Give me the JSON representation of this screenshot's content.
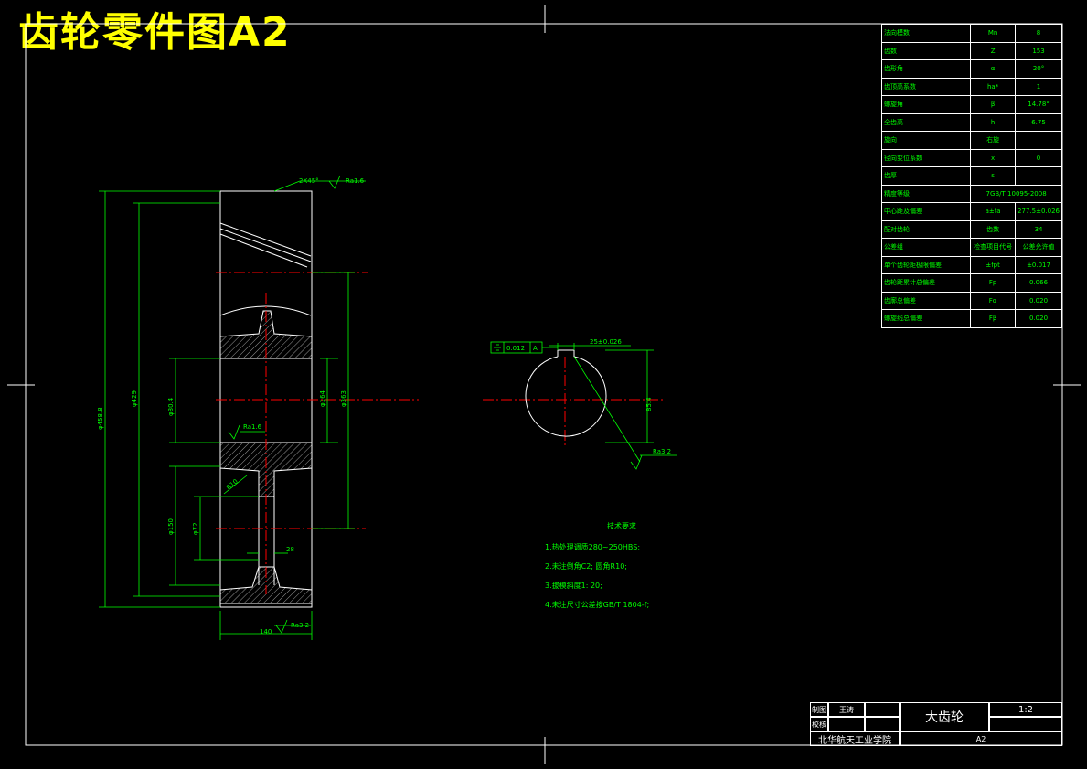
{
  "sheet_title": "齿轮零件图A2",
  "params": [
    [
      "法向模数",
      "Mn",
      "8"
    ],
    [
      "齿数",
      "Z",
      "153"
    ],
    [
      "齿形角",
      "α",
      "20°"
    ],
    [
      "齿顶高系数",
      "ha*",
      "1"
    ],
    [
      "螺旋角",
      "β",
      "14.78°"
    ],
    [
      "全齿高",
      "h",
      "6.75"
    ],
    [
      "旋向",
      "右旋",
      ""
    ],
    [
      "径向变位系数",
      "x",
      "0"
    ],
    [
      "齿厚",
      "s",
      ""
    ],
    [
      "精度等级",
      "7GB/T 10095-2008",
      ""
    ],
    [
      "中心距及偏差",
      "a±fa",
      "277.5±0.026"
    ],
    [
      "配对齿轮",
      "齿数",
      "34"
    ],
    [
      "公差组",
      "检查项目代号",
      "公差允许值"
    ],
    [
      "单个齿轮距极限偏差",
      "±fpt",
      "±0.017"
    ],
    [
      "齿轮距累计总偏差",
      "Fp",
      "0.066"
    ],
    [
      "齿廓总偏差",
      "Fα",
      "0.020"
    ],
    [
      "螺旋线总偏差",
      "Fβ",
      "0.020"
    ]
  ],
  "tech": {
    "heading": "技术要求",
    "items": [
      "1.热处理调质280~250HBS;",
      "2.未注倒角C2; 圆角R10;",
      "3.拔模斜度1: 20;",
      "4.未注尺寸公差按GB/T 1804-f;"
    ]
  },
  "title_block": {
    "draw_label": "制图",
    "drawer": "王涛",
    "check_label": "校核",
    "part_name": "大齿轮",
    "scale": "1:2",
    "school": "北华航天工业学院",
    "sheet": "A2"
  },
  "dims": {
    "chamfer": "2X45°",
    "ra16_top": "Ra1.6",
    "ra16_mid": "Ra1.6",
    "ra32_bottom": "Ra3.2",
    "ra32_key": "Ra3.2",
    "width": "140",
    "d_outer": "φ458.8",
    "d_root": "φ429",
    "d_bore": "φ80.4",
    "d_hub": "φ164",
    "d_web": "φ363",
    "d_150": "φ150",
    "d_72": "φ72",
    "web_thick": "28",
    "r10": "R10",
    "key_w": "25±0.026",
    "key_t": "85.4",
    "tol": "0.012",
    "datum": "A"
  }
}
